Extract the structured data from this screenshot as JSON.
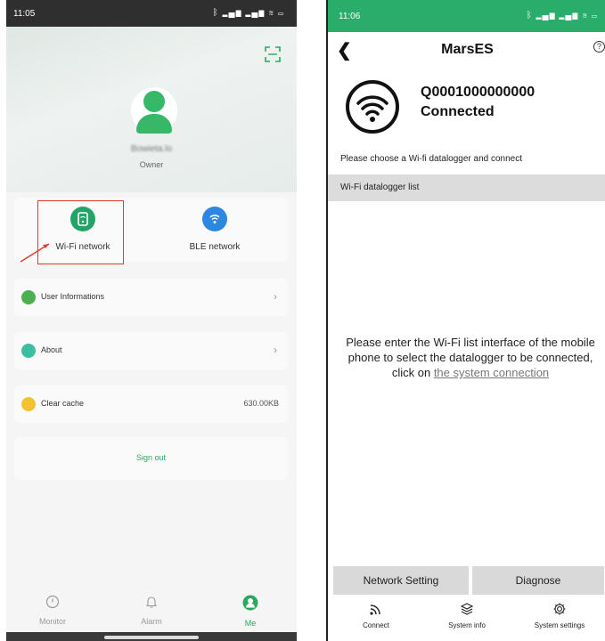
{
  "left": {
    "status_time": "11:05",
    "status_icons": "ᛒ ▂▄▆ ▂▄▆ ≋ ▭",
    "profile": {
      "username": "Bowieta.lo",
      "role": "Owner"
    },
    "network": {
      "wifi_label": "Wi-Fi network",
      "ble_label": "BLE network"
    },
    "menu": {
      "user_info": "User Informations",
      "about": "About",
      "clear_cache": "Clear cache",
      "cache_size": "630.00KB",
      "sign_out": "Sign out"
    },
    "tabs": [
      {
        "label": "Monitor",
        "icon": "monitor-icon"
      },
      {
        "label": "Alarm",
        "icon": "bell-icon"
      },
      {
        "label": "Me",
        "icon": "person-icon"
      }
    ],
    "colors": {
      "accent": "#2aa862",
      "wifi": "#23a368",
      "ble": "#2d86e0",
      "highlight": "#e23b2b"
    }
  },
  "right": {
    "status_time": "11:06",
    "status_icons": "ᛒ ▂▄▆ ▂▄▆ ≋ ▭",
    "title": "MarsES",
    "device": {
      "id": "Q0001000000000",
      "status": "Connected"
    },
    "choose_text": "Please choose a Wi-fi datalogger and connect",
    "list_header": "Wi-Fi datalogger list",
    "instruction": {
      "text": "Please enter the Wi-Fi list interface of the mobile phone to select the datalogger to be connected, click on",
      "link": "the system connection"
    },
    "buttons": {
      "network_setting": "Network Setting",
      "diagnose": "Diagnose"
    },
    "tabs": [
      {
        "label": "Connect",
        "icon": "connect-icon"
      },
      {
        "label": "System info",
        "icon": "layers-icon"
      },
      {
        "label": "System settings",
        "icon": "gear-icon"
      }
    ],
    "colors": {
      "status_bar": "#2aac6b"
    }
  }
}
